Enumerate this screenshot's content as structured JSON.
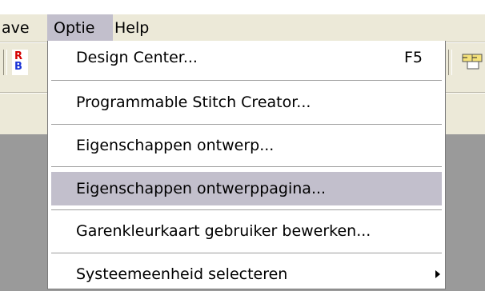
{
  "menubar": {
    "items": [
      {
        "label": "ave"
      },
      {
        "label": "Optie"
      },
      {
        "label": "Help"
      }
    ]
  },
  "toolbar": {
    "icons": [
      "rb-color-icon",
      "stitch-grid-icon"
    ],
    "rb_icon": {
      "top": "R",
      "bottom": "B",
      "top_color": "#d40000",
      "bottom_color": "#1a33d6"
    }
  },
  "dropdown": {
    "items": [
      {
        "label": "Design Center...",
        "shortcut": "F5"
      },
      {
        "label": "Programmable Stitch Creator..."
      },
      {
        "label": "Eigenschappen ontwerp..."
      },
      {
        "label": "Eigenschappen ontwerppagina...",
        "highlighted": true
      },
      {
        "label": "Garenkleurkaart gebruiker bewerken..."
      },
      {
        "label": "Systeemeenheid selecteren",
        "submenu": true
      }
    ]
  },
  "colors": {
    "menu_bg": "#ece9d8",
    "highlight": "#c2bfcc",
    "workspace": "#9a9a9a"
  }
}
